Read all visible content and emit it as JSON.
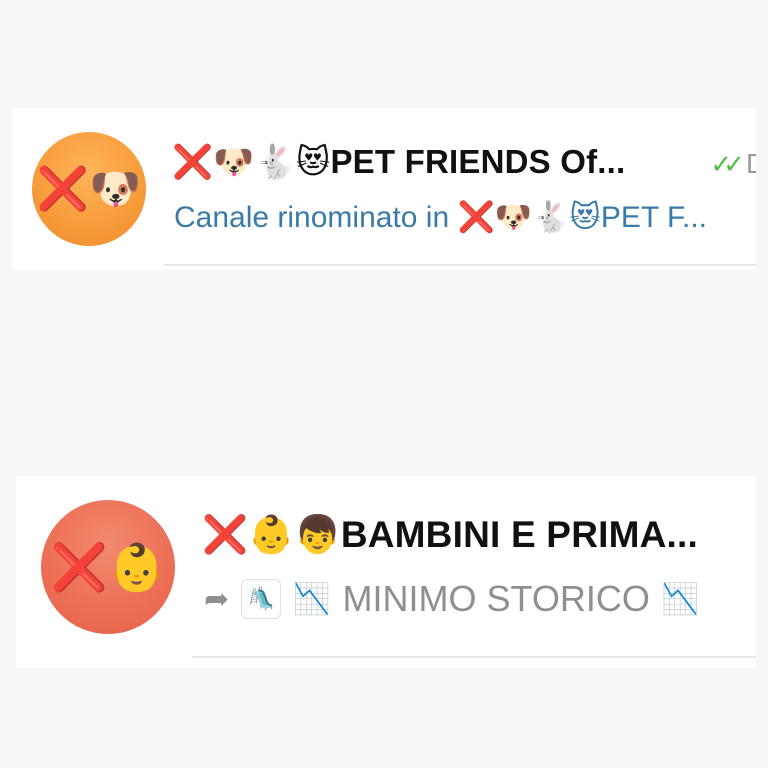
{
  "chats": [
    {
      "avatar_glyphs": "❌🐶",
      "avatar_color": "#f69b3a",
      "title_emoji": "❌🐶🐇😻",
      "title_text": "PET FRIENDS Of...",
      "status_icon": "double-check-icon",
      "status_color": "#4fbf4a",
      "time_text": "Do",
      "subtitle_text": "Canale rinominato in ",
      "subtitle_emoji": "❌🐶🐇😻",
      "subtitle_text_end": "PET F..."
    },
    {
      "avatar_glyphs": "❌👶",
      "avatar_color": "#ec6e55",
      "title_emoji": "❌👶👦",
      "title_text": "BAMBINI E PRIMA...",
      "subtitle_forward_icon": "forward-arrow-icon",
      "subtitle_thumb_icon": "trampoline-thumbnail",
      "subtitle_chart_icon": "chart-decreasing-icon",
      "subtitle_text": "MINIMO STORICO"
    }
  ]
}
